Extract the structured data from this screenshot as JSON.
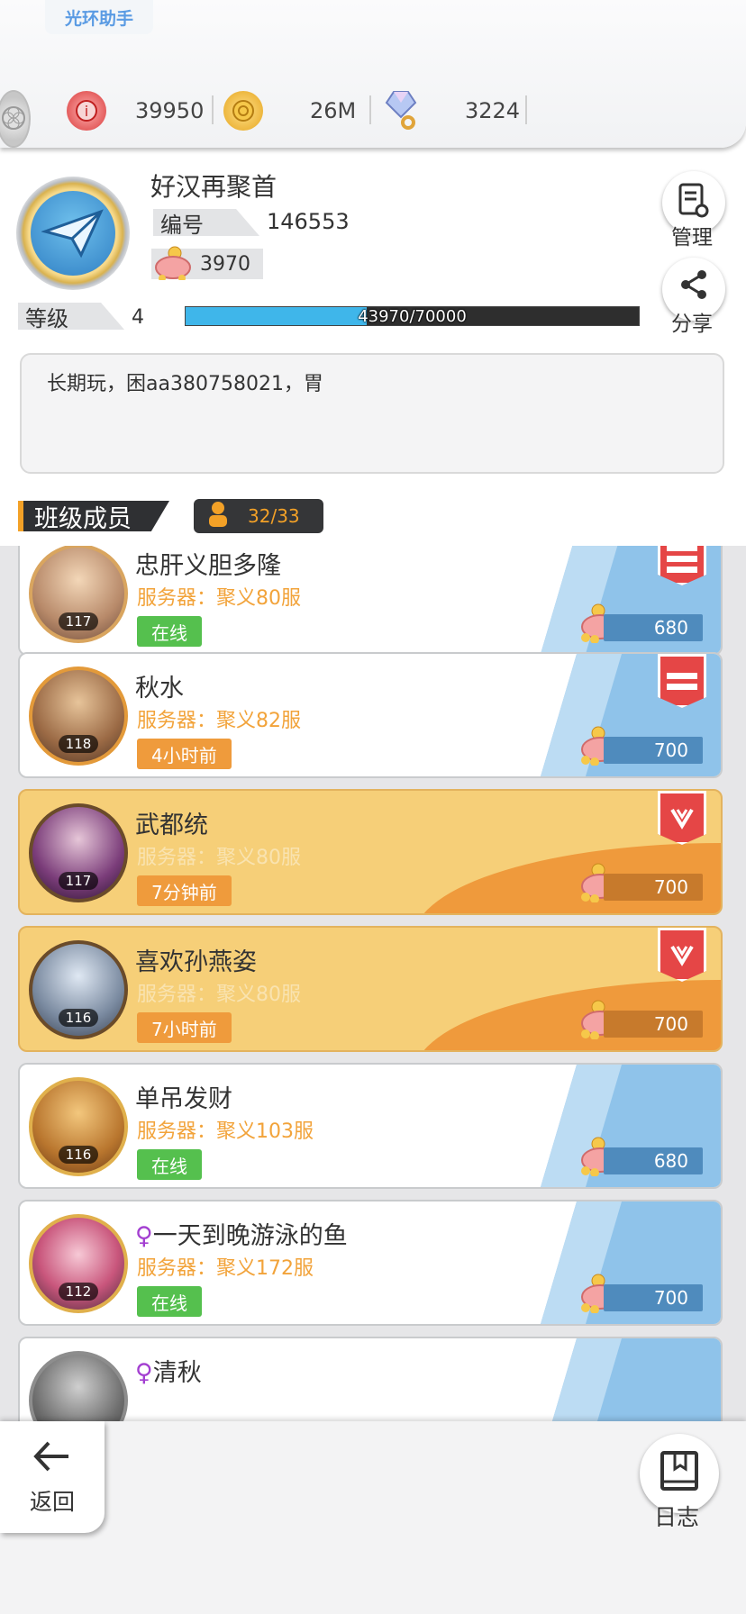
{
  "helper_tag": "光环助手",
  "currencies": [
    {
      "icon": "red-token-icon",
      "value": "39950",
      "color": "#e24a4a"
    },
    {
      "icon": "gold-coin-icon",
      "value": "26M",
      "color": "#f1b636"
    },
    {
      "icon": "crystal-key-icon",
      "value": "3224",
      "color": "#8ab0ef"
    }
  ],
  "profile": {
    "name": "好汉再聚首",
    "id_label": "编号",
    "id_value": "146553",
    "pig_value": "3970",
    "level_label": "等级",
    "level_value": "4",
    "progress_text": "43970/70000",
    "progress_fraction": 0.4,
    "bio": "长期玩，困aa380758021，胃"
  },
  "actions": {
    "manage": "管理",
    "share": "分享"
  },
  "members_section": {
    "title": "班级成员",
    "count": "32/33"
  },
  "members": [
    {
      "name": "忠肝义胆多隆",
      "server": "服务器：聚义80服",
      "status": "在线",
      "status_type": "online",
      "level": "117",
      "pig": "680",
      "style": "white",
      "flag": "red-star",
      "gender": ""
    },
    {
      "name": "秋水",
      "server": "服务器：聚义82服",
      "status": "4小时前",
      "status_type": "offline",
      "level": "118",
      "pig": "700",
      "style": "white",
      "flag": "red",
      "gender": ""
    },
    {
      "name": "武都统",
      "server": "服务器：聚义80服",
      "status": "7分钟前",
      "status_type": "offline",
      "level": "117",
      "pig": "700",
      "style": "gold",
      "flag": "shield",
      "gender": ""
    },
    {
      "name": "喜欢孙燕姿",
      "server": "服务器：聚义80服",
      "status": "7小时前",
      "status_type": "offline",
      "level": "116",
      "pig": "700",
      "style": "gold",
      "flag": "shield",
      "gender": ""
    },
    {
      "name": "单吊发财",
      "server": "服务器：聚义103服",
      "status": "在线",
      "status_type": "online",
      "level": "116",
      "pig": "680",
      "style": "white",
      "flag": "",
      "gender": ""
    },
    {
      "name": "一天到晚游泳的鱼",
      "server": "服务器：聚义172服",
      "status": "在线",
      "status_type": "online",
      "level": "112",
      "pig": "700",
      "style": "white",
      "flag": "",
      "gender": "♀"
    },
    {
      "name": "清秋",
      "server": "",
      "status": "",
      "status_type": "",
      "level": "",
      "pig": "",
      "style": "white",
      "flag": "",
      "gender": "♀"
    }
  ],
  "bottom": {
    "back": "返回",
    "log": "日志"
  }
}
